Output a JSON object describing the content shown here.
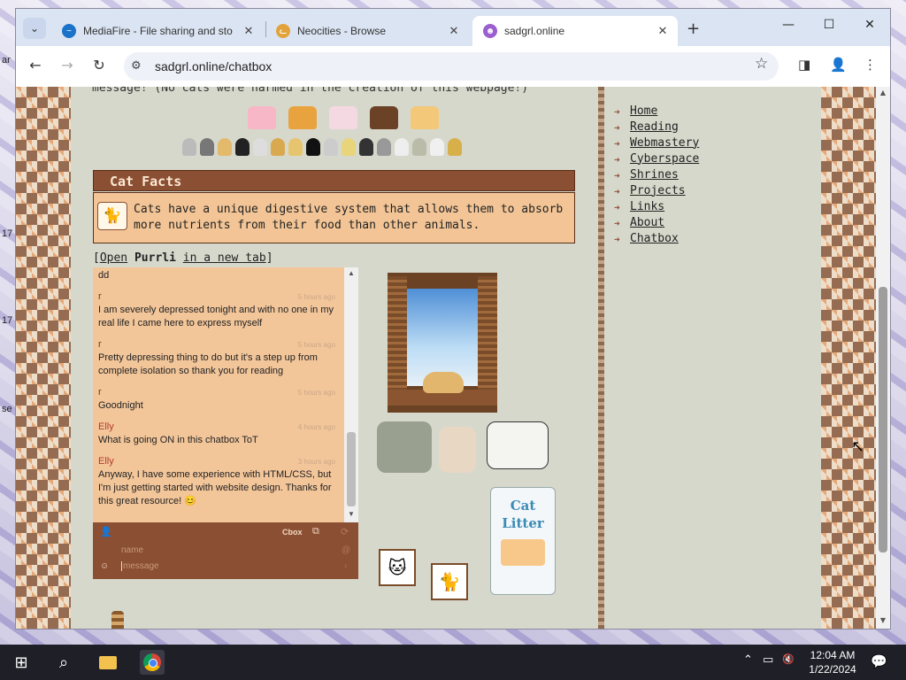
{
  "desktop": {
    "frag_a": "ar",
    "frag_17a": "17",
    "frag_17b": "17",
    "frag_se": "se"
  },
  "browser": {
    "tabs": [
      {
        "title": "MediaFire - File sharing and sto",
        "close": "✕",
        "fav_color": "#1a73c8",
        "fav_glyph": "~"
      },
      {
        "title": "Neocities - Browse",
        "close": "✕",
        "fav_color": "#e2a33b",
        "fav_glyph": "ᓚ"
      },
      {
        "title": "sadgrl.online",
        "close": "✕",
        "fav_color": "#9b5fd0",
        "fav_glyph": "☻"
      }
    ],
    "tab_search": "⌄",
    "new_tab": "+",
    "controls": {
      "minimize": "—",
      "maximize": "☐",
      "close": "✕"
    },
    "nav": {
      "back": "←",
      "forward": "→",
      "reload": "↻"
    },
    "url": "sadgrl.online/chatbox",
    "site_info_icon": "⚙",
    "bookmark": "☆",
    "sidepanel": "◨",
    "profile": "👤",
    "menu": "⋮"
  },
  "page": {
    "cutoff_text": "message! (No cats were harmed in the creation of this webpage!)",
    "cat_facts": {
      "title": "Cat Facts",
      "text": "Cats have a unique digestive system that allows them to absorb more nutrients from their food than other animals.",
      "icon": "🐈"
    },
    "open_link": {
      "open": "Open",
      "brand": "Purrli",
      "rest": "in a new tab"
    },
    "chat": {
      "messages": [
        {
          "name": "",
          "text": "dd",
          "time": ""
        },
        {
          "name": "r",
          "text": "I am severely depressed tonight and with no one in my real life I came here to express myself",
          "time": "5 hours ago"
        },
        {
          "name": "r",
          "text": "Pretty depressing thing to do but it's a step up from complete isolation so thank you for reading",
          "time": "5 hours ago"
        },
        {
          "name": "r",
          "text": "Goodnight",
          "time": "5 hours ago"
        },
        {
          "name": "Elly",
          "text": "What is going ON in this chatbox ToT",
          "time": "4 hours ago"
        },
        {
          "name": "Elly",
          "text": "Anyway, I have some experience with HTML/CSS, but I'm just getting started with website design. Thanks for this great resource! 😊",
          "time": "3 hours ago"
        }
      ],
      "footer": {
        "user_icon": "👤",
        "cbox": "Cbox",
        "popout_icon": "⧉",
        "refresh_icon": "⟳",
        "name_placeholder": "name",
        "message_placeholder": "message",
        "emoji_icon": "☺",
        "at_icon": "@",
        "send_icon": "›"
      }
    },
    "litter": {
      "line1": "Cat",
      "line2": "Litter"
    },
    "nav": [
      {
        "label": "Home"
      },
      {
        "label": "Reading"
      },
      {
        "label": "Webmastery"
      },
      {
        "label": "Cyberspace"
      },
      {
        "label": "Shrines"
      },
      {
        "label": "Projects"
      },
      {
        "label": "Links"
      },
      {
        "label": "About"
      },
      {
        "label": "Chatbox"
      }
    ]
  },
  "taskbar": {
    "time": "12:04 AM",
    "date": "1/22/2024",
    "start_icon": "⊞",
    "search_icon": "⌕",
    "notif_icon": "💬",
    "tray_chevron": "⌃",
    "tray_net": "▭",
    "tray_vol": "🔇"
  }
}
